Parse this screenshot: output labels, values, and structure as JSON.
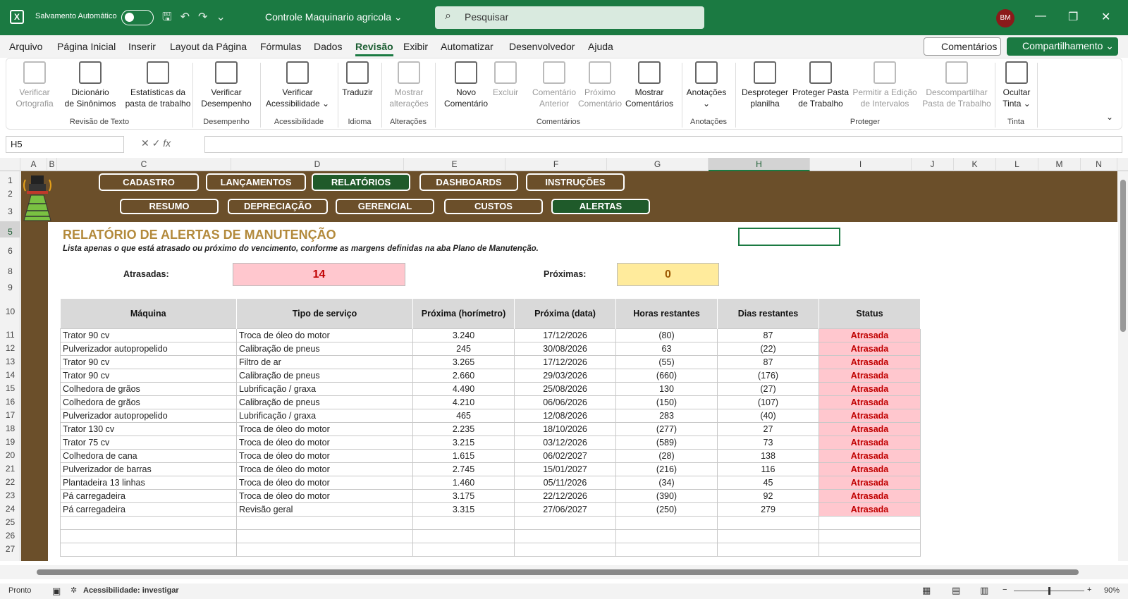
{
  "titlebar": {
    "autosave_label": "Salvamento Automático",
    "doc_title": "Controle Maquinario agricola ⌄",
    "search_placeholder": "Pesquisar",
    "avatar": "BM",
    "minimize": "—",
    "restore": "❐",
    "close": "✕"
  },
  "menu": {
    "tabs": [
      "Arquivo",
      "Página Inicial",
      "Inserir",
      "Layout da Página",
      "Fórmulas",
      "Dados",
      "Revisão",
      "Exibir",
      "Automatizar",
      "Desenvolvedor",
      "Ajuda"
    ],
    "active": "Revisão",
    "comments_btn": "Comentários",
    "share_btn": "Compartilhamento ⌄"
  },
  "ribbon": {
    "buttons": [
      {
        "l1": "Verificar",
        "l2": "Ortografia",
        "dim": true
      },
      {
        "l1": "Dicionário",
        "l2": "de Sinônimos",
        "dim": false
      },
      {
        "l1": "Estatísticas da",
        "l2": "pasta de trabalho",
        "dim": false
      },
      {
        "l1": "Verificar",
        "l2": "Desempenho",
        "dim": false
      },
      {
        "l1": "Verificar",
        "l2": "Acessibilidade ⌄",
        "dim": false
      },
      {
        "l1": "Traduzir",
        "l2": "",
        "dim": false
      },
      {
        "l1": "Mostrar",
        "l2": "alterações",
        "dim": true
      },
      {
        "l1": "Novo",
        "l2": "Comentário",
        "dim": false
      },
      {
        "l1": "Excluir",
        "l2": "",
        "dim": true
      },
      {
        "l1": "Comentário",
        "l2": "Anterior",
        "dim": true
      },
      {
        "l1": "Próximo",
        "l2": "Comentário",
        "dim": true
      },
      {
        "l1": "Mostrar",
        "l2": "Comentários",
        "dim": false
      },
      {
        "l1": "Anotações",
        "l2": "⌄",
        "dim": false
      },
      {
        "l1": "Desproteger",
        "l2": "planilha",
        "dim": false
      },
      {
        "l1": "Proteger Pasta",
        "l2": "de Trabalho",
        "dim": false
      },
      {
        "l1": "Permitir a Edição",
        "l2": "de Intervalos",
        "dim": true
      },
      {
        "l1": "Descompartilhar",
        "l2": "Pasta de Trabalho",
        "dim": true
      },
      {
        "l1": "Ocultar",
        "l2": "Tinta ⌄",
        "dim": false
      }
    ],
    "groups": [
      "Revisão de Texto",
      "Desempenho",
      "Acessibilidade",
      "Idioma",
      "Alterações",
      "Comentários",
      "Anotações",
      "Proteger",
      "Tinta"
    ]
  },
  "formula_bar": {
    "name_box": "H5",
    "fx": "fx",
    "value": ""
  },
  "columns": [
    "A",
    "B",
    "C",
    "D",
    "E",
    "F",
    "G",
    "H",
    "I",
    "J",
    "K",
    "L",
    "M",
    "N"
  ],
  "selected_column": "H",
  "rows": [
    "1",
    "2",
    "3",
    "5",
    "6",
    "8",
    "9",
    "10",
    "11",
    "12",
    "13",
    "14",
    "15",
    "16",
    "17",
    "18",
    "19",
    "20",
    "21",
    "22",
    "23",
    "24",
    "25",
    "26",
    "27"
  ],
  "selected_row": "5",
  "nav": {
    "top": [
      {
        "label": "CADASTRO",
        "active": false
      },
      {
        "label": "LANÇAMENTOS",
        "active": false
      },
      {
        "label": "RELATÓRIOS",
        "active": true
      },
      {
        "label": "DASHBOARDS",
        "active": false
      },
      {
        "label": "INSTRUÇÕES",
        "active": false
      }
    ],
    "sub": [
      {
        "label": "RESUMO",
        "active": false
      },
      {
        "label": "DEPRECIAÇÃO",
        "active": false
      },
      {
        "label": "GERENCIAL",
        "active": false
      },
      {
        "label": "CUSTOS",
        "active": false
      },
      {
        "label": "ALERTAS",
        "active": true
      }
    ]
  },
  "report": {
    "title": "RELATÓRIO DE ALERTAS DE MANUTENÇÃO",
    "subtitle": "Lista apenas o que está atrasado ou próximo do vencimento, conforme as margens definidas na aba Plano de Manutenção.",
    "atrasadas_label": "Atrasadas:",
    "atrasadas_value": "14",
    "proximas_label": "Próximas:",
    "proximas_value": "0",
    "colors": {
      "late_bg": "#ffc7ce",
      "late_text": "#c00000",
      "next_bg": "#ffeb9c",
      "next_text": "#9c5700"
    }
  },
  "table": {
    "headers": [
      "Máquina",
      "Tipo de serviço",
      "Próxima (horímetro)",
      "Próxima (data)",
      "Horas restantes",
      "Dias restantes",
      "Status"
    ],
    "rows": [
      [
        "Trator 90 cv",
        "Troca de óleo do motor",
        "3.240",
        "17/12/2026",
        "(80)",
        "87",
        "Atrasada"
      ],
      [
        "Pulverizador autopropelido",
        "Calibração de pneus",
        "245",
        "30/08/2026",
        "63",
        "(22)",
        "Atrasada"
      ],
      [
        "Trator 90 cv",
        "Filtro de ar",
        "3.265",
        "17/12/2026",
        "(55)",
        "87",
        "Atrasada"
      ],
      [
        "Trator 90 cv",
        "Calibração de pneus",
        "2.660",
        "29/03/2026",
        "(660)",
        "(176)",
        "Atrasada"
      ],
      [
        "Colhedora de grãos",
        "Lubrificação / graxa",
        "4.490",
        "25/08/2026",
        "130",
        "(27)",
        "Atrasada"
      ],
      [
        "Colhedora de grãos",
        "Calibração de pneus",
        "4.210",
        "06/06/2026",
        "(150)",
        "(107)",
        "Atrasada"
      ],
      [
        "Pulverizador autopropelido",
        "Lubrificação / graxa",
        "465",
        "12/08/2026",
        "283",
        "(40)",
        "Atrasada"
      ],
      [
        "Trator 130 cv",
        "Troca de óleo do motor",
        "2.235",
        "18/10/2026",
        "(277)",
        "27",
        "Atrasada"
      ],
      [
        "Trator 75 cv",
        "Troca de óleo do motor",
        "3.215",
        "03/12/2026",
        "(589)",
        "73",
        "Atrasada"
      ],
      [
        "Colhedora de cana",
        "Troca de óleo do motor",
        "1.615",
        "06/02/2027",
        "(28)",
        "138",
        "Atrasada"
      ],
      [
        "Pulverizador de barras",
        "Troca de óleo do motor",
        "2.745",
        "15/01/2027",
        "(216)",
        "116",
        "Atrasada"
      ],
      [
        "Plantadeira 13 linhas",
        "Troca de óleo do motor",
        "1.460",
        "05/11/2026",
        "(34)",
        "45",
        "Atrasada"
      ],
      [
        "Pá carregadeira",
        "Troca de óleo do motor",
        "3.175",
        "22/12/2026",
        "(390)",
        "92",
        "Atrasada"
      ],
      [
        "Pá carregadeira",
        "Revisão geral",
        "3.315",
        "27/06/2027",
        "(250)",
        "279",
        "Atrasada"
      ],
      [
        "",
        "",
        "",
        "",
        "",
        "",
        ""
      ],
      [
        "",
        "",
        "",
        "",
        "",
        "",
        ""
      ],
      [
        "",
        "",
        "",
        "",
        "",
        "",
        ""
      ]
    ]
  },
  "statusbar": {
    "ready": "Pronto",
    "accessibility": "Acessibilidade: investigar",
    "zoom": "90%"
  }
}
